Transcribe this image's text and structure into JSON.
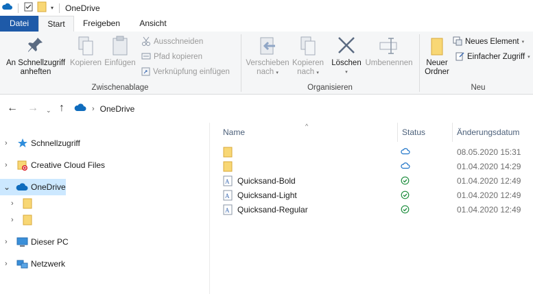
{
  "window": {
    "title": "OneDrive"
  },
  "ribbon_tabs": {
    "file": "Datei",
    "start": "Start",
    "share": "Freigeben",
    "view": "Ansicht"
  },
  "ribbon": {
    "pin": {
      "line1": "An Schnellzugriff",
      "line2": "anheften"
    },
    "copy": "Kopieren",
    "paste": "Einfügen",
    "cut": "Ausschneiden",
    "copy_path": "Pfad kopieren",
    "paste_shortcut": "Verknüpfung einfügen",
    "clipboard_group": "Zwischenablage",
    "move_to": {
      "line1": "Verschieben",
      "line2": "nach"
    },
    "copy_to": {
      "line1": "Kopieren",
      "line2": "nach"
    },
    "delete": "Löschen",
    "rename": "Umbenennen",
    "organize_group": "Organisieren",
    "new_folder": {
      "line1": "Neuer",
      "line2": "Ordner"
    },
    "new_item": "Neues Element",
    "easy_access": "Einfacher Zugriff",
    "new_group": "Neu"
  },
  "address": {
    "crumb": "OneDrive"
  },
  "nav": [
    {
      "label": "Schnellzugriff"
    },
    {
      "label": "Creative Cloud Files"
    },
    {
      "label": "OneDrive"
    },
    {
      "label": ""
    },
    {
      "label": ""
    },
    {
      "label": "Dieser PC"
    },
    {
      "label": "Netzwerk"
    }
  ],
  "columns": {
    "name": "Name",
    "status": "Status",
    "date": "Änderungsdatum"
  },
  "files": [
    {
      "name": "",
      "type": "folder",
      "status": "cloud",
      "date": "08.05.2020 15:31"
    },
    {
      "name": "",
      "type": "folder",
      "status": "cloud",
      "date": "01.04.2020 14:29"
    },
    {
      "name": "Quicksand-Bold",
      "type": "font",
      "status": "synced",
      "date": "01.04.2020 12:49"
    },
    {
      "name": "Quicksand-Light",
      "type": "font",
      "status": "synced",
      "date": "01.04.2020 12:49"
    },
    {
      "name": "Quicksand-Regular",
      "type": "font",
      "status": "synced",
      "date": "01.04.2020 12:49"
    }
  ],
  "colors": {
    "accent": "#1e5aa8",
    "selection": "#cce8ff",
    "folder": "#f8d775",
    "onedrive": "#0f6cbd",
    "synced": "#1e8e3e"
  }
}
